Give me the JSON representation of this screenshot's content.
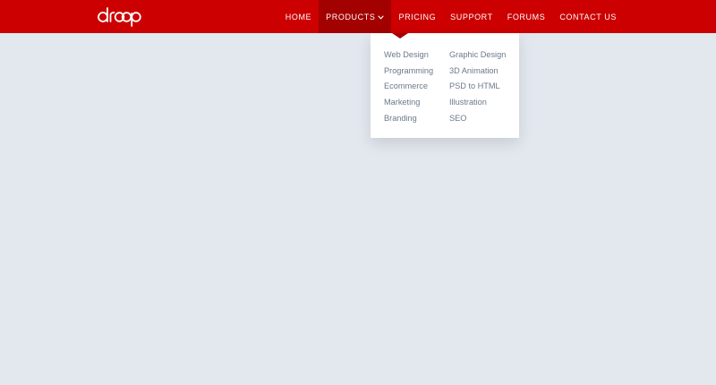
{
  "brand": {
    "logo_text": "droop"
  },
  "nav": {
    "items": [
      {
        "label": "HOME"
      },
      {
        "label": "PRODUCTS"
      },
      {
        "label": "PRICING"
      },
      {
        "label": "SUPPORT"
      },
      {
        "label": "FORUMS"
      },
      {
        "label": "CONTACT US"
      }
    ],
    "active": "PRODUCTS"
  },
  "dropdown": {
    "left_column": [
      "Web Design",
      "Programming",
      "Ecommerce",
      "Marketing",
      "Branding"
    ],
    "right_column": [
      "Graphic Design",
      "3D Animation",
      "PSD to HTML",
      "Illustration",
      "SEO"
    ]
  },
  "colors": {
    "navbar": "#cc0000",
    "active_tab": "#a30000",
    "page_bg": "#e3e8ef",
    "dropdown_text": "#6b7a8c"
  },
  "icons": {
    "products_caret": "chevron-down-icon"
  }
}
